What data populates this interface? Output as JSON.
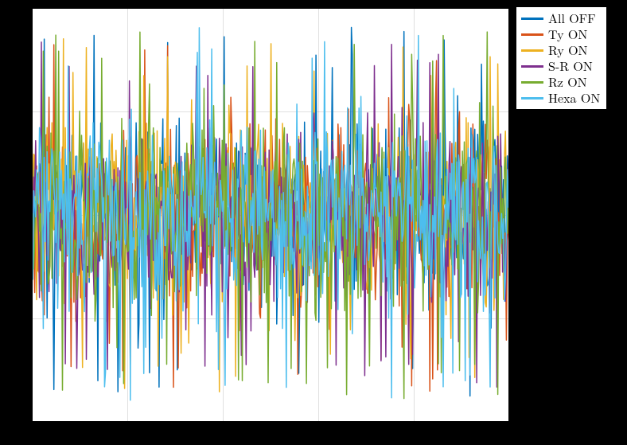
{
  "chart_data": {
    "type": "line",
    "title": "",
    "xlabel": "",
    "ylabel": "",
    "xlim": [
      0,
      500
    ],
    "ylim": [
      -1.1,
      1.1
    ],
    "grid_x": [
      0,
      100,
      200,
      300,
      400,
      500
    ],
    "grid_y": [
      -1.1,
      -0.55,
      0,
      0.55,
      1.1
    ],
    "description": "Six overlaid dense noise traces filling a horizontal band roughly from -0.8 to 0.8 with occasional spikes reaching ±1.0. No visible tick labels.",
    "series": [
      {
        "name": "All OFF",
        "color": "#0072bd",
        "kind": "dense-noise",
        "amp_main": 0.78,
        "amp_spike": 1.0,
        "n": 500
      },
      {
        "name": "Ty ON",
        "color": "#d95319",
        "kind": "dense-noise",
        "amp_main": 0.76,
        "amp_spike": 0.96,
        "n": 500
      },
      {
        "name": "Ry ON",
        "color": "#edb120",
        "kind": "dense-noise",
        "amp_main": 0.74,
        "amp_spike": 0.94,
        "n": 500
      },
      {
        "name": "S-R ON",
        "color": "#7e2f8e",
        "kind": "dense-noise",
        "amp_main": 0.74,
        "amp_spike": 0.92,
        "n": 500
      },
      {
        "name": "Rz ON",
        "color": "#77ac30",
        "kind": "dense-noise",
        "amp_main": 0.78,
        "amp_spike": 0.98,
        "n": 500
      },
      {
        "name": "Hexa ON",
        "color": "#4dbeee",
        "kind": "dense-noise",
        "amp_main": 0.8,
        "amp_spike": 1.0,
        "n": 500
      }
    ]
  },
  "legend": {
    "items": [
      {
        "label": "All OFF",
        "color": "#0072bd"
      },
      {
        "label": "Ty ON",
        "color": "#d95319"
      },
      {
        "label": "Ry ON",
        "color": "#edb120"
      },
      {
        "label": "S-R ON",
        "color": "#7e2f8e"
      },
      {
        "label": "Rz ON",
        "color": "#77ac30"
      },
      {
        "label": "Hexa ON",
        "color": "#4dbeee"
      }
    ]
  }
}
